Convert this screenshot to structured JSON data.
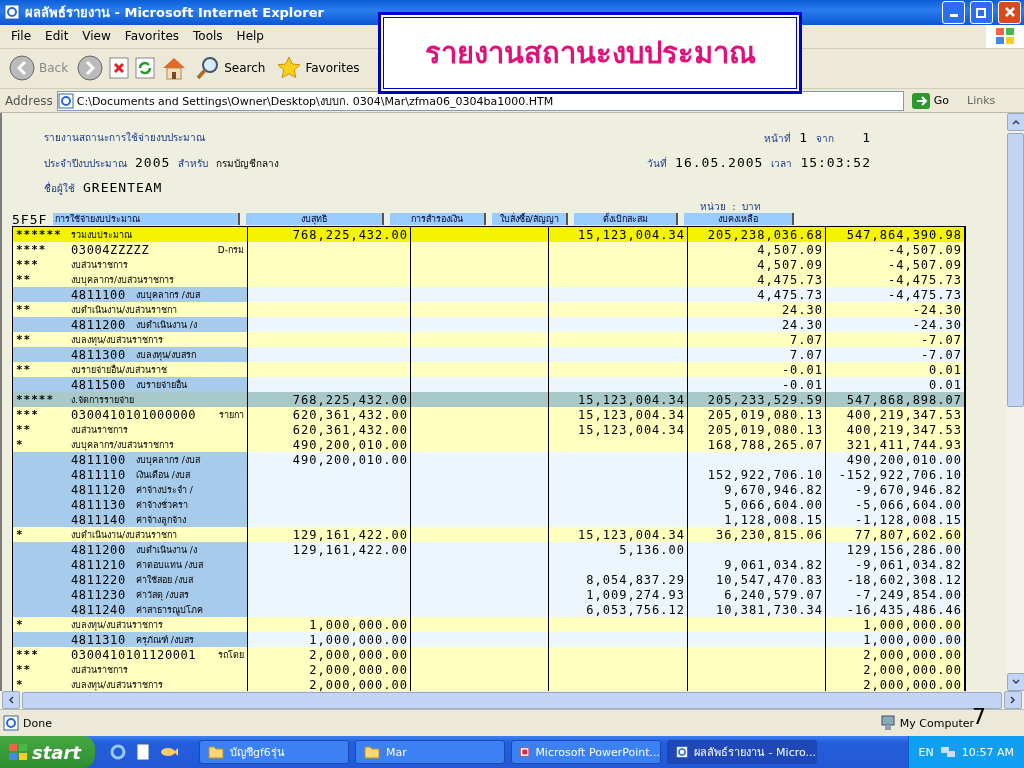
{
  "window": {
    "title": "ผลลัพธ์รายงาน - Microsoft Internet Explorer"
  },
  "menu": [
    "File",
    "Edit",
    "View",
    "Favorites",
    "Tools",
    "Help"
  ],
  "toolbar": [
    {
      "kind": "back",
      "label": "Back"
    },
    {
      "kind": "forward"
    },
    {
      "kind": "stop"
    },
    {
      "kind": "refresh"
    },
    {
      "kind": "home"
    },
    {
      "kind": "search",
      "label": "Search"
    },
    {
      "kind": "favorites",
      "label": "Favorites"
    }
  ],
  "address_bar": {
    "label": "Address",
    "value": "C:\\Documents and Settings\\Owner\\Desktop\\งบบก. 0304\\Mar\\zfma06_0304ba1000.HTM",
    "go": "Go",
    "links": "Links"
  },
  "banner": {
    "title": "รายงานสถานะงบประมาณ"
  },
  "report": {
    "title": "รายงานสถานะการใช้จ่ายงบประมาณ",
    "page_label": "หน้าที่",
    "page": "1",
    "of_label": "จาก",
    "pages": "1",
    "year_label": "ประจำปีงบประมาณ",
    "year": "2005",
    "for_label": "สำหรับ",
    "department": "กรมบัญชีกลาง",
    "date_label": "วันที่",
    "date": "16.05.2005",
    "time_label": "เวลา",
    "time": "15:03:52",
    "user_label": "ชื่อผู้ใช้",
    "user": "GREENTEAM",
    "unit": "หน่วย  :  บาท"
  },
  "table": {
    "code": "5F5F",
    "columns": [
      "การใช้จ่ายงบประมาณ",
      "งบสุทธิ",
      "การสำรองเงิน",
      "ใบสั่งซื้อ/สัญญา",
      "ตั้งเบิกสะสม",
      "งบคงเหลือ"
    ],
    "rows": [
      {
        "kind": "total",
        "level": "******",
        "name": "รวมงบประมาณ",
        "values": {
          "net": "768,225,432.00",
          "ordered": "15,123,004.34",
          "disbursed": "205,238,036.68",
          "balance": "547,864,390.98"
        }
      },
      {
        "kind": "group",
        "level": "****",
        "code": "03004ZZZZZ",
        "name": "D-กรม",
        "values": {
          "disbursed": "4,507.09",
          "balance": "-4,507.09"
        }
      },
      {
        "kind": "group",
        "level": "***",
        "name": "งบส่วนราชการ",
        "values": {
          "disbursed": "4,507.09",
          "balance": "-4,507.09"
        }
      },
      {
        "kind": "group",
        "level": "**",
        "name": "งบบุคลากร/งบส่วนราชการ",
        "values": {
          "disbursed": "4,475.73",
          "balance": "-4,475.73"
        }
      },
      {
        "kind": "item",
        "code": "4811100",
        "name": "งบบุคลากร /งบส",
        "values": {
          "disbursed": "4,475.73",
          "balance": "-4,475.73"
        }
      },
      {
        "kind": "group",
        "level": "**",
        "name": "งบดำเนินงาน/งบส่วนราชกา",
        "values": {
          "disbursed": "24.30",
          "balance": "-24.30"
        }
      },
      {
        "kind": "item",
        "code": "4811200",
        "name": "งบดำเนินงาน /ง",
        "values": {
          "disbursed": "24.30",
          "balance": "-24.30"
        }
      },
      {
        "kind": "group",
        "level": "**",
        "name": "งบลงทุน/งบส่วนราชการ",
        "values": {
          "disbursed": "7.07",
          "balance": "-7.07"
        }
      },
      {
        "kind": "item",
        "code": "4811300",
        "name": "งบลงทุน/งบสรก",
        "values": {
          "disbursed": "7.07",
          "balance": "-7.07"
        }
      },
      {
        "kind": "group",
        "level": "**",
        "name": "งบรายจ่ายอื่น/งบส่วนราช",
        "values": {
          "disbursed": "-0.01",
          "balance": "0.01"
        }
      },
      {
        "kind": "item",
        "code": "4811500",
        "name": "งบรายจ่ายอื่น",
        "values": {
          "disbursed": "-0.01",
          "balance": "0.01"
        }
      },
      {
        "kind": "section",
        "level": "*****",
        "name": "ง.จัดการรายจ่าย",
        "values": {
          "net": "768,225,432.00",
          "ordered": "15,123,004.34",
          "disbursed": "205,233,529.59",
          "balance": "547,868,898.07"
        }
      },
      {
        "kind": "group",
        "level": "***",
        "code": "0300410101000000",
        "name": "รายกา",
        "values": {
          "net": "620,361,432.00",
          "ordered": "15,123,004.34",
          "disbursed": "205,019,080.13",
          "balance": "400,219,347.53"
        }
      },
      {
        "kind": "group",
        "level": "**",
        "name": "งบส่วนราชการ",
        "values": {
          "net": "620,361,432.00",
          "ordered": "15,123,004.34",
          "disbursed": "205,019,080.13",
          "balance": "400,219,347.53"
        }
      },
      {
        "kind": "group",
        "level": "*",
        "name": "งบบุคลากร/งบส่วนราชการ",
        "values": {
          "net": "490,200,010.00",
          "disbursed": "168,788,265.07",
          "balance": "321,411,744.93"
        }
      },
      {
        "kind": "item",
        "code": "4811100",
        "name": "งบบุคลากร /งบส",
        "values": {
          "net": "490,200,010.00",
          "balance": "490,200,010.00"
        }
      },
      {
        "kind": "item",
        "code": "4811110",
        "name": "เงินเดือน /งบส",
        "values": {
          "disbursed": "152,922,706.10",
          "balance": "-152,922,706.10"
        }
      },
      {
        "kind": "item",
        "code": "4811120",
        "name": "ค่าจ้างประจำ /",
        "values": {
          "disbursed": "9,670,946.82",
          "balance": "-9,670,946.82"
        }
      },
      {
        "kind": "item",
        "code": "4811130",
        "name": "ค่าจ้างชั่วครา",
        "values": {
          "disbursed": "5,066,604.00",
          "balance": "-5,066,604.00"
        }
      },
      {
        "kind": "item",
        "code": "4811140",
        "name": "ค่าจ้างลูกจ้าง",
        "values": {
          "disbursed": "1,128,008.15",
          "balance": "-1,128,008.15"
        }
      },
      {
        "kind": "group",
        "level": "*",
        "name": "งบดำเนินงาน/งบส่วนราชกา",
        "values": {
          "net": "129,161,422.00",
          "ordered": "15,123,004.34",
          "disbursed": "36,230,815.06",
          "balance": "77,807,602.60"
        }
      },
      {
        "kind": "item",
        "code": "4811200",
        "name": "งบดำเนินงาน /ง",
        "values": {
          "net": "129,161,422.00",
          "ordered": "5,136.00",
          "balance": "129,156,286.00"
        }
      },
      {
        "kind": "item",
        "code": "4811210",
        "name": "ค่าตอบแทน /งบส",
        "values": {
          "disbursed": "9,061,034.82",
          "balance": "-9,061,034.82"
        }
      },
      {
        "kind": "item",
        "code": "4811220",
        "name": "ค่าใช้สอย /งบส",
        "values": {
          "ordered": "8,054,837.29",
          "disbursed": "10,547,470.83",
          "balance": "-18,602,308.12"
        }
      },
      {
        "kind": "item",
        "code": "4811230",
        "name": "ค่าวัสดุ /งบสร",
        "values": {
          "ordered": "1,009,274.93",
          "disbursed": "6,240,579.07",
          "balance": "-7,249,854.00"
        }
      },
      {
        "kind": "item",
        "code": "4811240",
        "name": "ค่าสาธารณูปโภค",
        "values": {
          "ordered": "6,053,756.12",
          "disbursed": "10,381,730.34",
          "balance": "-16,435,486.46"
        }
      },
      {
        "kind": "group",
        "level": "*",
        "name": "งบลงทุน/งบส่วนราชการ",
        "values": {
          "net": "1,000,000.00",
          "balance": "1,000,000.00"
        }
      },
      {
        "kind": "item",
        "code": "4811310",
        "name": "ครุภัณฑ์ /งบสร",
        "values": {
          "net": "1,000,000.00",
          "balance": "1,000,000.00"
        }
      },
      {
        "kind": "group",
        "level": "***",
        "code": "0300410101120001",
        "name": "รถโดย",
        "values": {
          "net": "2,000,000.00",
          "balance": "2,000,000.00"
        }
      },
      {
        "kind": "group",
        "level": "**",
        "name": "งบส่วนราชการ",
        "values": {
          "net": "2,000,000.00",
          "balance": "2,000,000.00"
        }
      },
      {
        "kind": "group",
        "level": "*",
        "name": "งบลงทุน/งบส่วนราชการ",
        "values": {
          "net": "2,000,000.00",
          "balance": "2,000,000.00"
        }
      }
    ]
  },
  "status_bar": {
    "status": "Done",
    "zone": "My Computer"
  },
  "slide_number": "7",
  "taskbar": {
    "start": "start",
    "tasks": [
      {
        "kind": "folder",
        "label": "บัญชีgf6รุ่น",
        "selected": false
      },
      {
        "kind": "folder",
        "label": "Mar",
        "selected": false
      },
      {
        "kind": "powerpoint",
        "label": "Microsoft PowerPoint...",
        "selected": false
      },
      {
        "kind": "browser",
        "label": "ผลลัพธ์รายงาน - Micro...",
        "selected": true
      }
    ],
    "language": "EN",
    "clock": "10:57 AM"
  }
}
